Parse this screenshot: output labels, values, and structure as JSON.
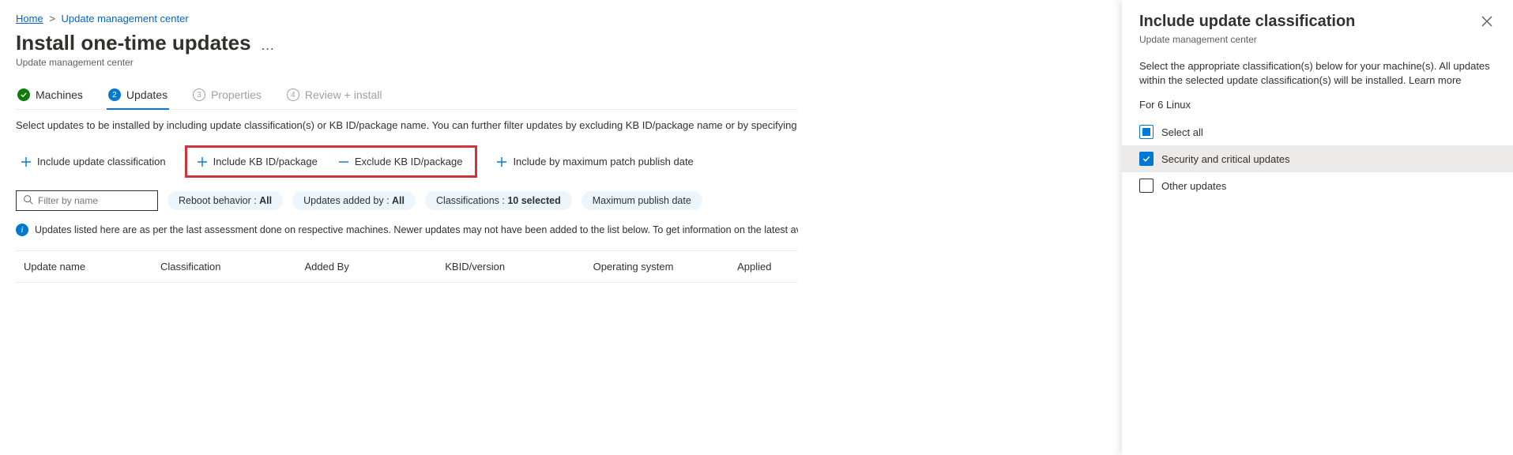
{
  "breadcrumb": {
    "home": "Home",
    "current": "Update management center"
  },
  "page": {
    "title": "Install one-time updates",
    "subtitle": "Update management center"
  },
  "steps": {
    "s1": {
      "label": "Machines"
    },
    "s2": {
      "num": "2",
      "label": "Updates"
    },
    "s3": {
      "num": "3",
      "label": "Properties"
    },
    "s4": {
      "num": "4",
      "label": "Review + install"
    }
  },
  "desc": "Select updates to be installed by including update classification(s) or KB ID/package name. You can further filter updates by excluding KB ID/package name or by specifying maximum patch pu",
  "toolbar": {
    "include_classification": "Include update classification",
    "include_kb": "Include KB ID/package",
    "exclude_kb": "Exclude KB ID/package",
    "include_date": "Include by maximum patch publish date"
  },
  "filter": {
    "search_placeholder": "Filter by name",
    "reboot_label": "Reboot behavior : ",
    "reboot_value": "All",
    "added_label": "Updates added by : ",
    "added_value": "All",
    "class_label": "Classifications : ",
    "class_value": "10 selected",
    "maxpub": "Maximum publish date"
  },
  "info": "Updates listed here are as per the last assessment done on respective machines. Newer updates may not have been added to the list below. To get information on the latest available updates, we recomm",
  "columns": {
    "c1": "Update name",
    "c2": "Classification",
    "c3": "Added By",
    "c4": "KBID/version",
    "c5": "Operating system",
    "c6": "Applied"
  },
  "panel": {
    "title": "Include update classification",
    "subtitle": "Update management center",
    "desc": "Select the appropriate classification(s) below for your machine(s). All updates within the selected update classification(s) will be installed. Learn more",
    "for": "For 6 Linux",
    "select_all": "Select all",
    "opt1": "Security and critical updates",
    "opt2": "Other updates"
  }
}
